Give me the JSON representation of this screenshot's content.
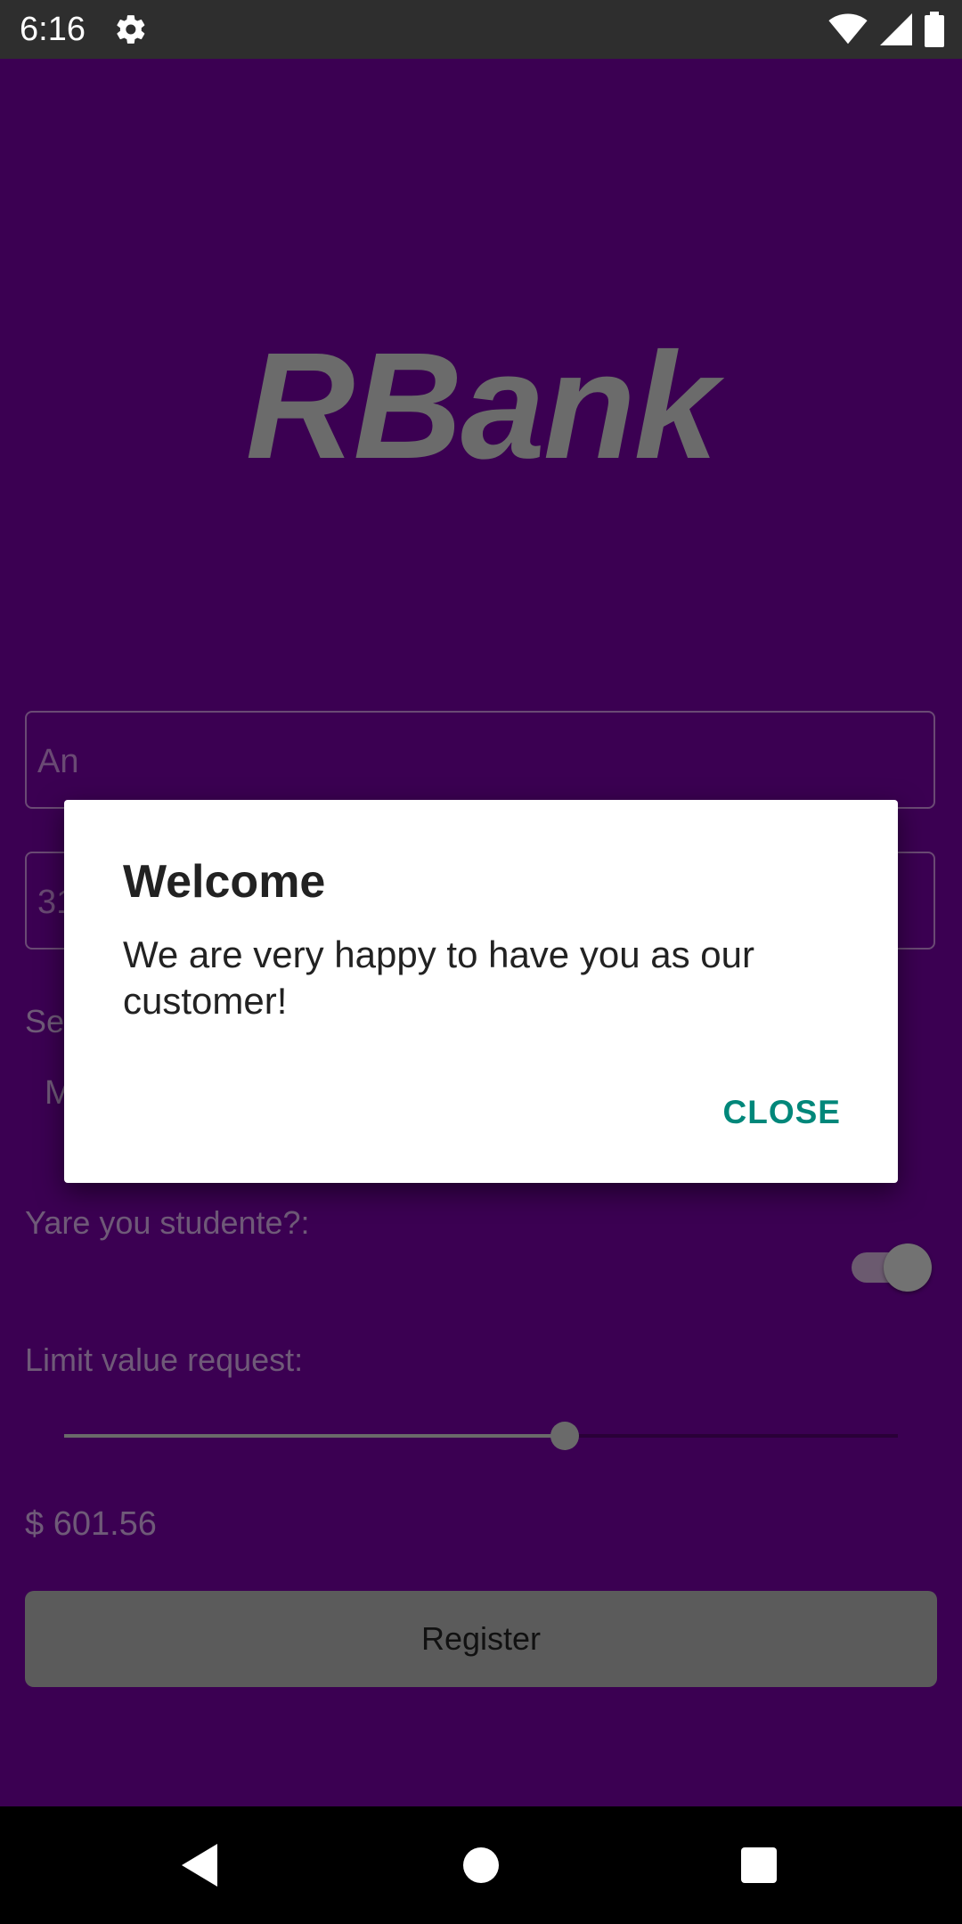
{
  "status_bar": {
    "time": "6:16",
    "icons": [
      "gear-icon",
      "wifi-icon",
      "signal-icon",
      "battery-icon"
    ]
  },
  "app": {
    "logo": "RBank",
    "fields": [
      {
        "value": "An"
      },
      {
        "value": "31"
      }
    ],
    "select_label": "Se",
    "select_value": "M",
    "student_label": "Yare you studente?:",
    "student_switch_on": true,
    "limit_label": "Limit value request:",
    "slider_fraction": 0.6,
    "amount": "$ 601.56",
    "register_label": "Register"
  },
  "dialog": {
    "title": "Welcome",
    "message": "We are very happy to have you as our customer!",
    "close_label": "CLOSE"
  },
  "colors": {
    "background": "#3b0052",
    "accent": "#00877a",
    "status_bar": "#2e2e2e"
  },
  "nav_bar": {
    "icons": [
      "back-icon",
      "home-icon",
      "recents-icon"
    ]
  }
}
